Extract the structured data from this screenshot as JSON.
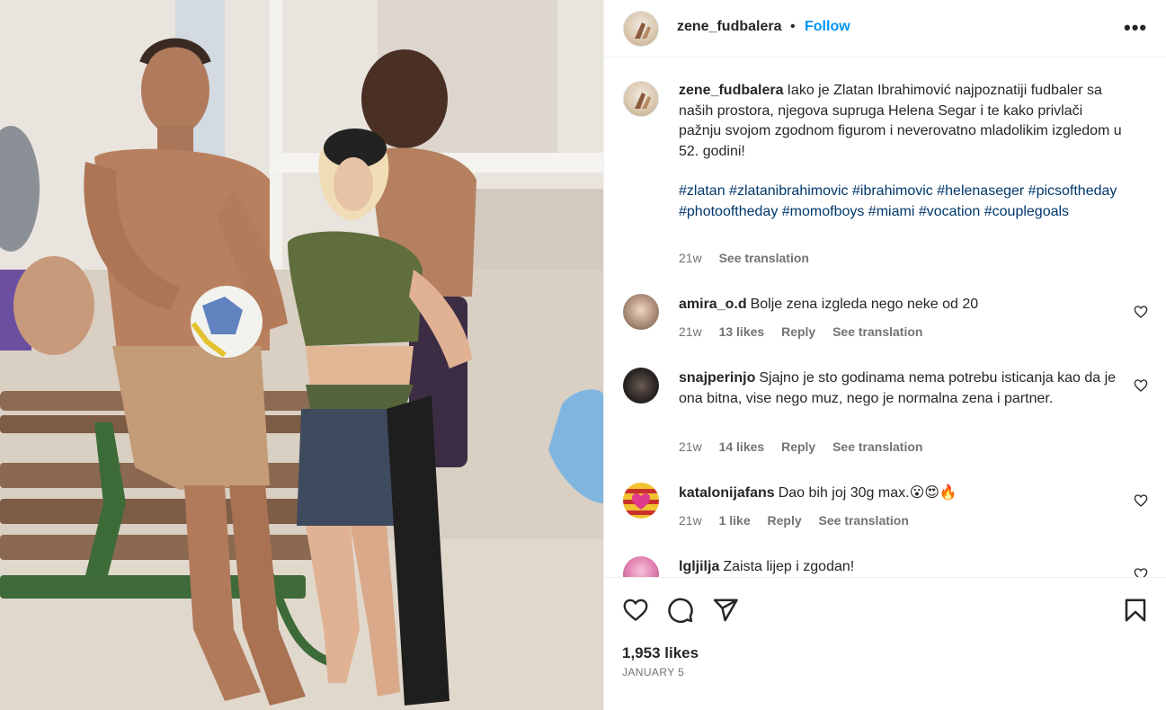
{
  "post": {
    "username": "zene_fudbalera",
    "separator": "•",
    "follow_label": "Follow",
    "more_label": "•••",
    "photo_icon": "beach-photo"
  },
  "caption": {
    "username": "zene_fudbalera",
    "text": "Iako je Zlatan Ibrahimović najpoznatiji fudbaler sa naših prostora, njegova supruga Helena Segar i te kako privlači pažnju svojom zgodnom figurom i neverovatno mladolikim izgledom u 52. godini!",
    "hashtags": "#zlatan #zlatanibrahimovic #ibrahimovic #helenaseger #picsoftheday #photooftheday #momofboys #miami #vocation #couplegoals",
    "age": "21w",
    "translate": "See translation"
  },
  "comments": [
    {
      "username": "amira_o.d",
      "text": "Bolje zena izgleda nego neke od 20",
      "age": "21w",
      "likes": "13 likes",
      "reply": "Reply",
      "translate": "See translation"
    },
    {
      "username": "snajperinjo",
      "text": "Sjajno je sto godinama nema potrebu isticanja kao da je ona bitna, vise nego muz, nego je normalna zena i partner.",
      "age": "21w",
      "likes": "14 likes",
      "reply": "Reply",
      "translate": "See translation"
    },
    {
      "username": "katalonijafans",
      "text": "Dao bih joj 30g max.😮😍🔥",
      "age": "21w",
      "likes": "1 like",
      "reply": "Reply",
      "translate": "See translation"
    },
    {
      "username": "lgljilja",
      "text": "Zaista lijep i zgodan!"
    }
  ],
  "footer": {
    "likes": "1,953 likes",
    "date": "JANUARY 5"
  },
  "icons": [
    "heart-icon",
    "comment-icon",
    "share-icon",
    "bookmark-icon",
    "more-icon"
  ],
  "colors": {
    "link": "#0095f6",
    "hashtag": "#00376b",
    "muted": "#737373",
    "text": "#262626"
  }
}
